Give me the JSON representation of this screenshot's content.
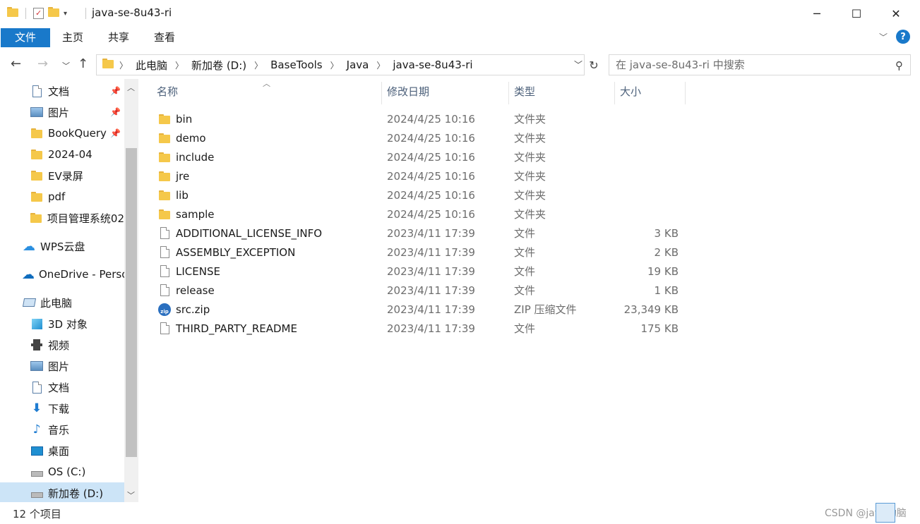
{
  "window": {
    "title": "java-se-8u43-ri",
    "controls": {
      "minimize": "─",
      "maximize": "☐",
      "close": "✕"
    }
  },
  "ribbon": {
    "tabs": [
      {
        "label": "文件",
        "active": true
      },
      {
        "label": "主页"
      },
      {
        "label": "共享"
      },
      {
        "label": "查看"
      }
    ],
    "help": "?"
  },
  "address": {
    "crumbs": [
      "此电脑",
      "新加卷 (D:)",
      "BaseTools",
      "Java",
      "java-se-8u43-ri"
    ]
  },
  "search": {
    "placeholder": "在 java-se-8u43-ri 中搜索"
  },
  "navpane": {
    "items": [
      {
        "label": "文档",
        "icon": "documents-icon",
        "pinned": true
      },
      {
        "label": "图片",
        "icon": "pictures-icon",
        "pinned": true
      },
      {
        "label": "BookQuery",
        "icon": "folder-icon",
        "pinned": true
      },
      {
        "label": "2024-04",
        "icon": "folder-icon"
      },
      {
        "label": "EV录屏",
        "icon": "folder-icon"
      },
      {
        "label": "pdf",
        "icon": "folder-icon"
      },
      {
        "label": "项目管理系统02",
        "icon": "folder-icon"
      },
      {
        "label": "WPS云盘",
        "icon": "cloud-icon"
      },
      {
        "label": "OneDrive - Perso",
        "icon": "onedrive-icon"
      },
      {
        "label": "此电脑",
        "icon": "this-pc-icon"
      },
      {
        "label": "3D 对象",
        "icon": "3d-objects-icon"
      },
      {
        "label": "视频",
        "icon": "videos-icon"
      },
      {
        "label": "图片",
        "icon": "pictures-icon"
      },
      {
        "label": "文档",
        "icon": "documents-icon"
      },
      {
        "label": "下载",
        "icon": "downloads-icon"
      },
      {
        "label": "音乐",
        "icon": "music-icon"
      },
      {
        "label": "桌面",
        "icon": "desktop-icon"
      },
      {
        "label": "OS (C:)",
        "icon": "drive-c-icon"
      },
      {
        "label": "新加卷 (D:)",
        "icon": "drive-d-icon",
        "selected": true
      }
    ]
  },
  "columns": [
    "名称",
    "修改日期",
    "类型",
    "大小"
  ],
  "files": [
    {
      "name": "bin",
      "date": "2024/4/25 10:16",
      "type": "文件夹",
      "size": "",
      "kind": "folder"
    },
    {
      "name": "demo",
      "date": "2024/4/25 10:16",
      "type": "文件夹",
      "size": "",
      "kind": "folder"
    },
    {
      "name": "include",
      "date": "2024/4/25 10:16",
      "type": "文件夹",
      "size": "",
      "kind": "folder"
    },
    {
      "name": "jre",
      "date": "2024/4/25 10:16",
      "type": "文件夹",
      "size": "",
      "kind": "folder"
    },
    {
      "name": "lib",
      "date": "2024/4/25 10:16",
      "type": "文件夹",
      "size": "",
      "kind": "folder"
    },
    {
      "name": "sample",
      "date": "2024/4/25 10:16",
      "type": "文件夹",
      "size": "",
      "kind": "folder"
    },
    {
      "name": "ADDITIONAL_LICENSE_INFO",
      "date": "2023/4/11 17:39",
      "type": "文件",
      "size": "3 KB",
      "kind": "file"
    },
    {
      "name": "ASSEMBLY_EXCEPTION",
      "date": "2023/4/11 17:39",
      "type": "文件",
      "size": "2 KB",
      "kind": "file"
    },
    {
      "name": "LICENSE",
      "date": "2023/4/11 17:39",
      "type": "文件",
      "size": "19 KB",
      "kind": "file"
    },
    {
      "name": "release",
      "date": "2023/4/11 17:39",
      "type": "文件",
      "size": "1 KB",
      "kind": "file"
    },
    {
      "name": "src.zip",
      "date": "2023/4/11 17:39",
      "type": "ZIP 压缩文件",
      "size": "23,349 KB",
      "kind": "zip"
    },
    {
      "name": "THIRD_PARTY_README",
      "date": "2023/4/11 17:39",
      "type": "文件",
      "size": "175 KB",
      "kind": "file"
    }
  ],
  "status": {
    "count": "12 个项目"
  },
  "watermark": "CSDN @java动脑",
  "colors": {
    "accent": "#1979ca",
    "selected": "#cce4f7",
    "folder": "#f5c84a"
  }
}
